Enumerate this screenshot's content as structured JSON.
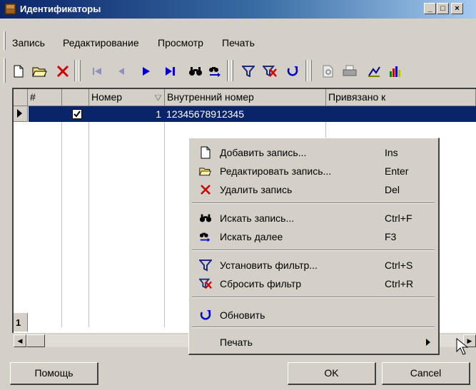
{
  "window": {
    "title": "Идентификаторы",
    "controls": [
      "_",
      "□",
      "×"
    ]
  },
  "menubar": {
    "items": [
      "Запись",
      "Редактирование",
      "Просмотр",
      "Печать"
    ]
  },
  "toolbar": {
    "buttons": [
      "new-record-icon",
      "edit-record-icon",
      "delete-record-icon",
      "first-record-icon",
      "prev-record-icon",
      "next-record-icon",
      "last-record-icon",
      "search-icon",
      "search-next-icon",
      "filter-icon",
      "clear-filter-icon",
      "refresh-icon",
      "print-preview-icon",
      "print-icon",
      "chart-edit-icon",
      "chart-icon"
    ]
  },
  "grid": {
    "columns": [
      "#",
      "",
      "Номер",
      "Внутренний номер",
      "Привязано к"
    ],
    "rows": [
      {
        "checked": true,
        "number": "1",
        "internal_number": "12345678912345",
        "bound_to": ""
      }
    ],
    "footer_count": "1"
  },
  "context_menu": {
    "items": [
      {
        "label": "Добавить запись...",
        "shortcut": "Ins",
        "icon": "new-record-icon"
      },
      {
        "label": "Редактировать запись...",
        "shortcut": "Enter",
        "icon": "edit-record-icon"
      },
      {
        "label": "Удалить запись",
        "shortcut": "Del",
        "icon": "delete-record-icon"
      },
      {
        "label": "Искать запись...",
        "shortcut": "Ctrl+F",
        "icon": "search-icon"
      },
      {
        "label": "Искать далее",
        "shortcut": "F3",
        "icon": "search-next-icon"
      },
      {
        "label": "Установить фильтр...",
        "shortcut": "Ctrl+S",
        "icon": "filter-icon"
      },
      {
        "label": "Сбросить фильтр",
        "shortcut": "Ctrl+R",
        "icon": "clear-filter-icon"
      },
      {
        "label": "Обновить",
        "shortcut": "",
        "icon": "refresh-icon"
      },
      {
        "label": "Печать",
        "shortcut": "",
        "icon": "submenu-arrow-icon"
      }
    ]
  },
  "buttons": {
    "help": "Помощь",
    "ok": "OK",
    "cancel": "Cancel"
  },
  "colors": {
    "selection": "#0a246a",
    "delete_red": "#cc0000",
    "nav_blue": "#0000cc",
    "filter_navy": "#1c2a7a"
  }
}
